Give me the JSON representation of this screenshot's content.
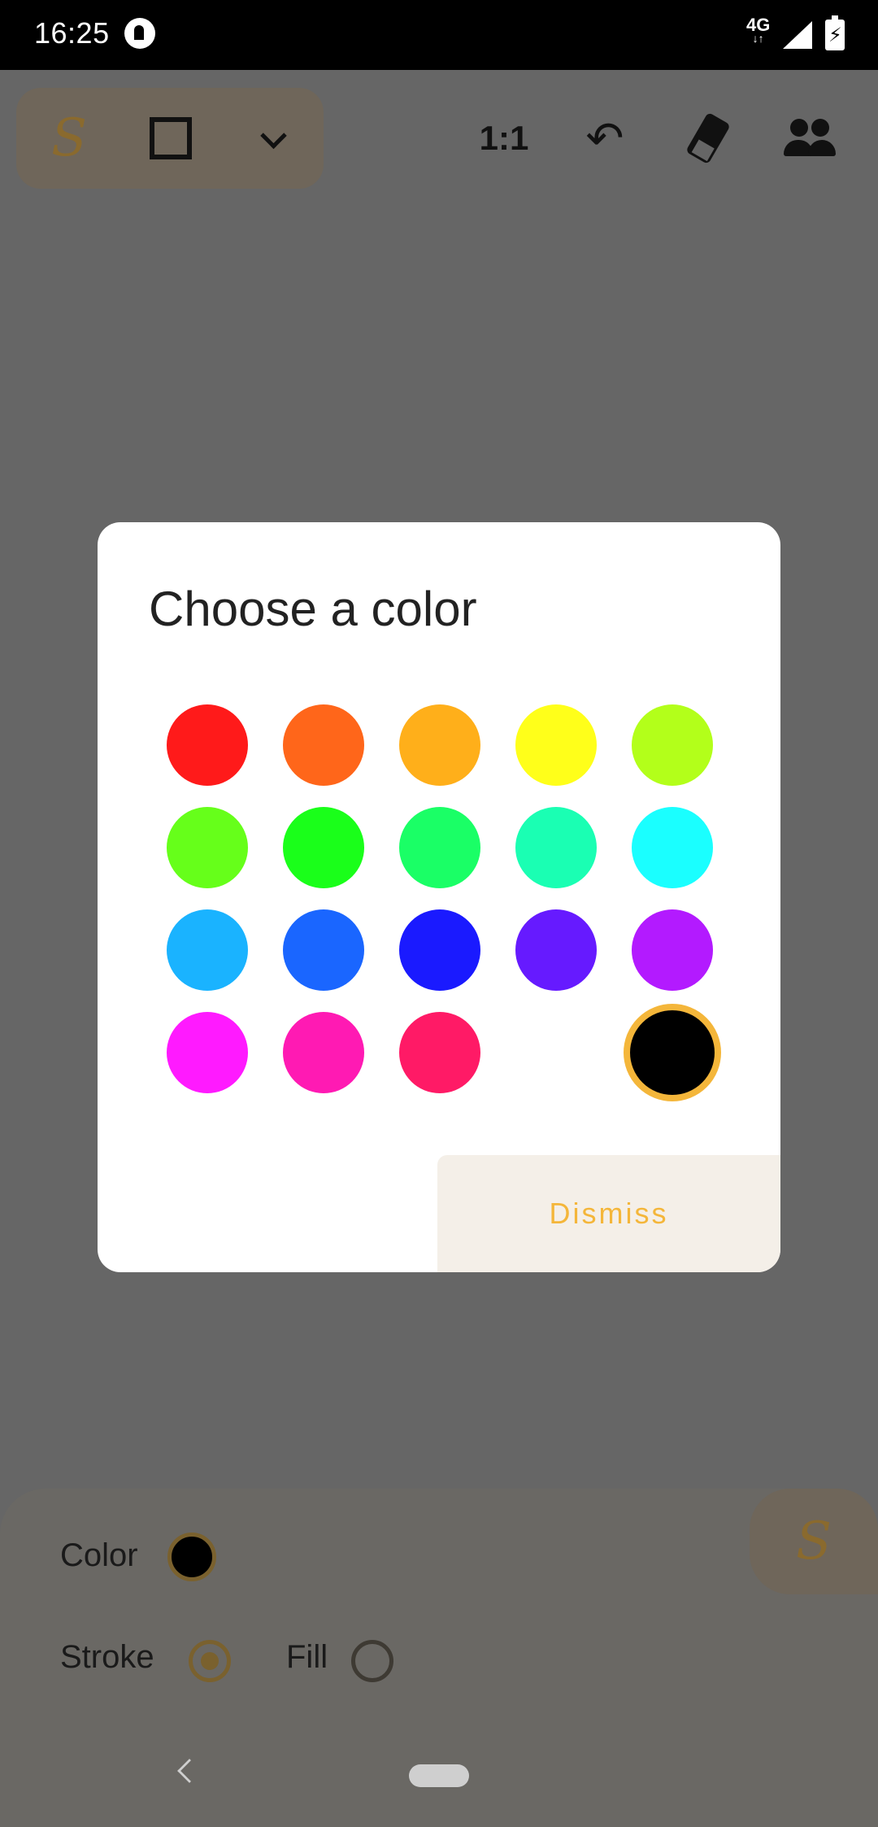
{
  "status_bar": {
    "time": "16:25",
    "network": "4G",
    "network_arrows": "↓↑",
    "battery_glyph": "⚡",
    "icons": [
      "app-notification-icon",
      "network-4g-icon",
      "signal-icon",
      "battery-charging-icon"
    ]
  },
  "toolbar": {
    "pen_glyph": "S",
    "ratio_label": "1:1",
    "undo_glyph": "↶",
    "icons": [
      "pen-icon",
      "rectangle-icon",
      "chevron-down-icon",
      "undo-icon",
      "eraser-icon",
      "people-icon"
    ]
  },
  "bottom_panel": {
    "color_label": "Color",
    "stroke_label": "Stroke",
    "fill_label": "Fill",
    "current_color": "#000000",
    "stroke_selected": true,
    "fill_selected": false,
    "fab_glyph": "S"
  },
  "dialog": {
    "title": "Choose a color",
    "dismiss_label": "Dismiss",
    "accent_color": "#f4b63a",
    "selected_color": "#000000",
    "colors": [
      [
        "#ff1a1a",
        "#ff661a",
        "#ffaf1a",
        "#ffff1a",
        "#b3ff1a"
      ],
      [
        "#66ff1a",
        "#1aff1a",
        "#1aff66",
        "#1affb3",
        "#1affff"
      ],
      [
        "#1ab3ff",
        "#1a66ff",
        "#1a1aff",
        "#661aff",
        "#b31aff"
      ],
      [
        "#ff1aff",
        "#ff1ab3",
        "#ff1a66",
        null,
        "#000000"
      ]
    ]
  },
  "nav_bar": {
    "icons": [
      "back-icon",
      "home-pill-icon"
    ]
  }
}
